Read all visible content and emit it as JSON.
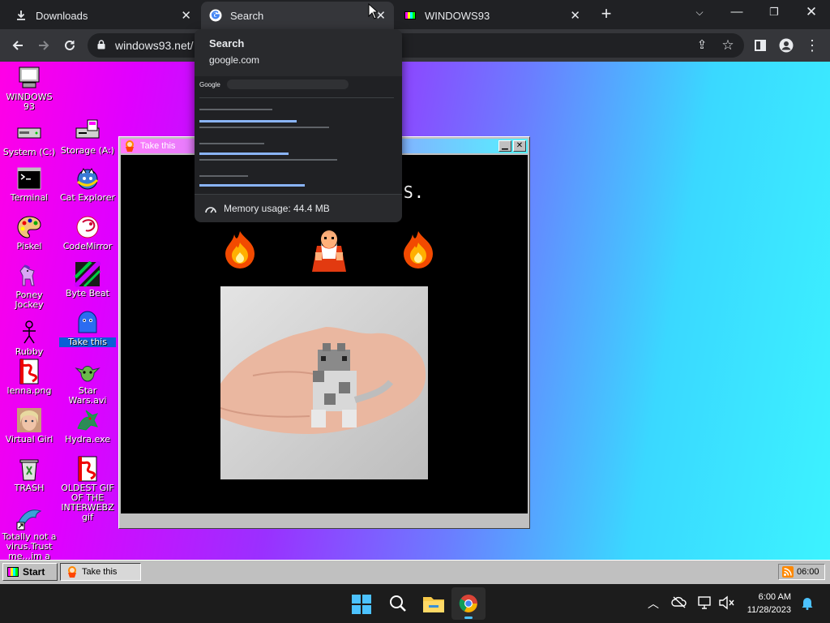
{
  "browser": {
    "tabs": [
      {
        "label": "Downloads",
        "icon": "download-icon"
      },
      {
        "label": "Search",
        "icon": "google-icon"
      },
      {
        "label": "WINDOWS93",
        "icon": "windows93-icon"
      }
    ],
    "url": "windows93.net/",
    "hover_card": {
      "title": "Search",
      "domain": "google.com",
      "memory": "Memory usage: 44.4 MB",
      "thumbnail_logo": "Google"
    }
  },
  "desktop": {
    "icons": [
      {
        "label": "WINDOWS 93",
        "icon": "computer-icon"
      },
      {
        "label": "System (C:)",
        "icon": "drive-icon"
      },
      {
        "label": "Storage (A:)",
        "icon": "floppy-drive-icon"
      },
      {
        "label": "Terminal",
        "icon": "terminal-icon"
      },
      {
        "label": "Cat Explorer",
        "icon": "cat-explorer-icon"
      },
      {
        "label": "Piskel",
        "icon": "palette-icon"
      },
      {
        "label": "CodeMirror",
        "icon": "codemirror-icon"
      },
      {
        "label": "Poney Jockey",
        "icon": "pony-icon"
      },
      {
        "label": "Byte Beat",
        "icon": "bytebeat-icon"
      },
      {
        "label": "Rubby",
        "icon": "stickman-icon"
      },
      {
        "label": "Take this",
        "icon": "wizard-icon"
      },
      {
        "label": "lenna.png",
        "icon": "image-file-icon"
      },
      {
        "label": "Star Wars.avi",
        "icon": "yoda-icon"
      },
      {
        "label": "Virtual Girl",
        "icon": "face-icon"
      },
      {
        "label": "Hydra.exe",
        "icon": "dragon-icon"
      },
      {
        "label": "TRASH",
        "icon": "trash-icon"
      },
      {
        "label": "OLDEST GIF OF THE INTERWEBZ gif",
        "icon": "image-file-icon"
      },
      {
        "label": "Totally not a virus.Trust me...im a",
        "icon": "dolphin-icon"
      }
    ]
  },
  "window": {
    "title": "Take this",
    "message": "IT'S D                        ! TAKE THIS."
  },
  "w93_taskbar": {
    "start_label": "Start",
    "task_label": "Take this",
    "tray_time": "06:00"
  },
  "os_taskbar": {
    "time": "6:00 AM",
    "date": "11/28/2023"
  }
}
